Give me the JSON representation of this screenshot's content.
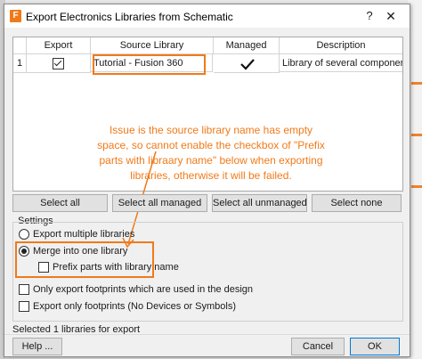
{
  "window": {
    "title": "Export Electronics Libraries from Schematic",
    "app_icon_letter": "F",
    "help_glyph": "?",
    "close_glyph": "✕"
  },
  "table": {
    "headers": [
      "Export",
      "Source Library",
      "Managed",
      "Description"
    ],
    "rows": [
      {
        "index": "1",
        "export_checked": true,
        "source_library": "Tutorial - Fusion 360",
        "managed": true,
        "description": "Library of several components ..."
      }
    ]
  },
  "annotation": {
    "text": "Issue is the source library name has empty space, so cannot enable the checkbox of \"Prefix parts with libraary name\" below when exporting libraries, otherwise it will be failed.",
    "color": "#f07a1a"
  },
  "buttons": {
    "select_all": "Select all",
    "select_all_managed": "Select all managed",
    "select_all_unmanaged": "Select all unmanaged",
    "select_none": "Select none",
    "help": "Help ...",
    "cancel": "Cancel",
    "ok": "OK"
  },
  "settings": {
    "label": "Settings",
    "export_multiple": {
      "label": "Export multiple libraries",
      "selected": false
    },
    "merge_into_one": {
      "label": "Merge into one library",
      "selected": true
    },
    "prefix_parts": {
      "label": "Prefix parts with library name",
      "checked": false
    },
    "only_used_footprints": {
      "label": "Only export footprints which are used in the design",
      "checked": false
    },
    "only_footprints": {
      "label": "Export only footprints (No Devices or Symbols)",
      "checked": false
    }
  },
  "status": "Selected 1 libraries for export",
  "colors": {
    "accent": "#f07a1a",
    "primary_border": "#0078d7"
  }
}
